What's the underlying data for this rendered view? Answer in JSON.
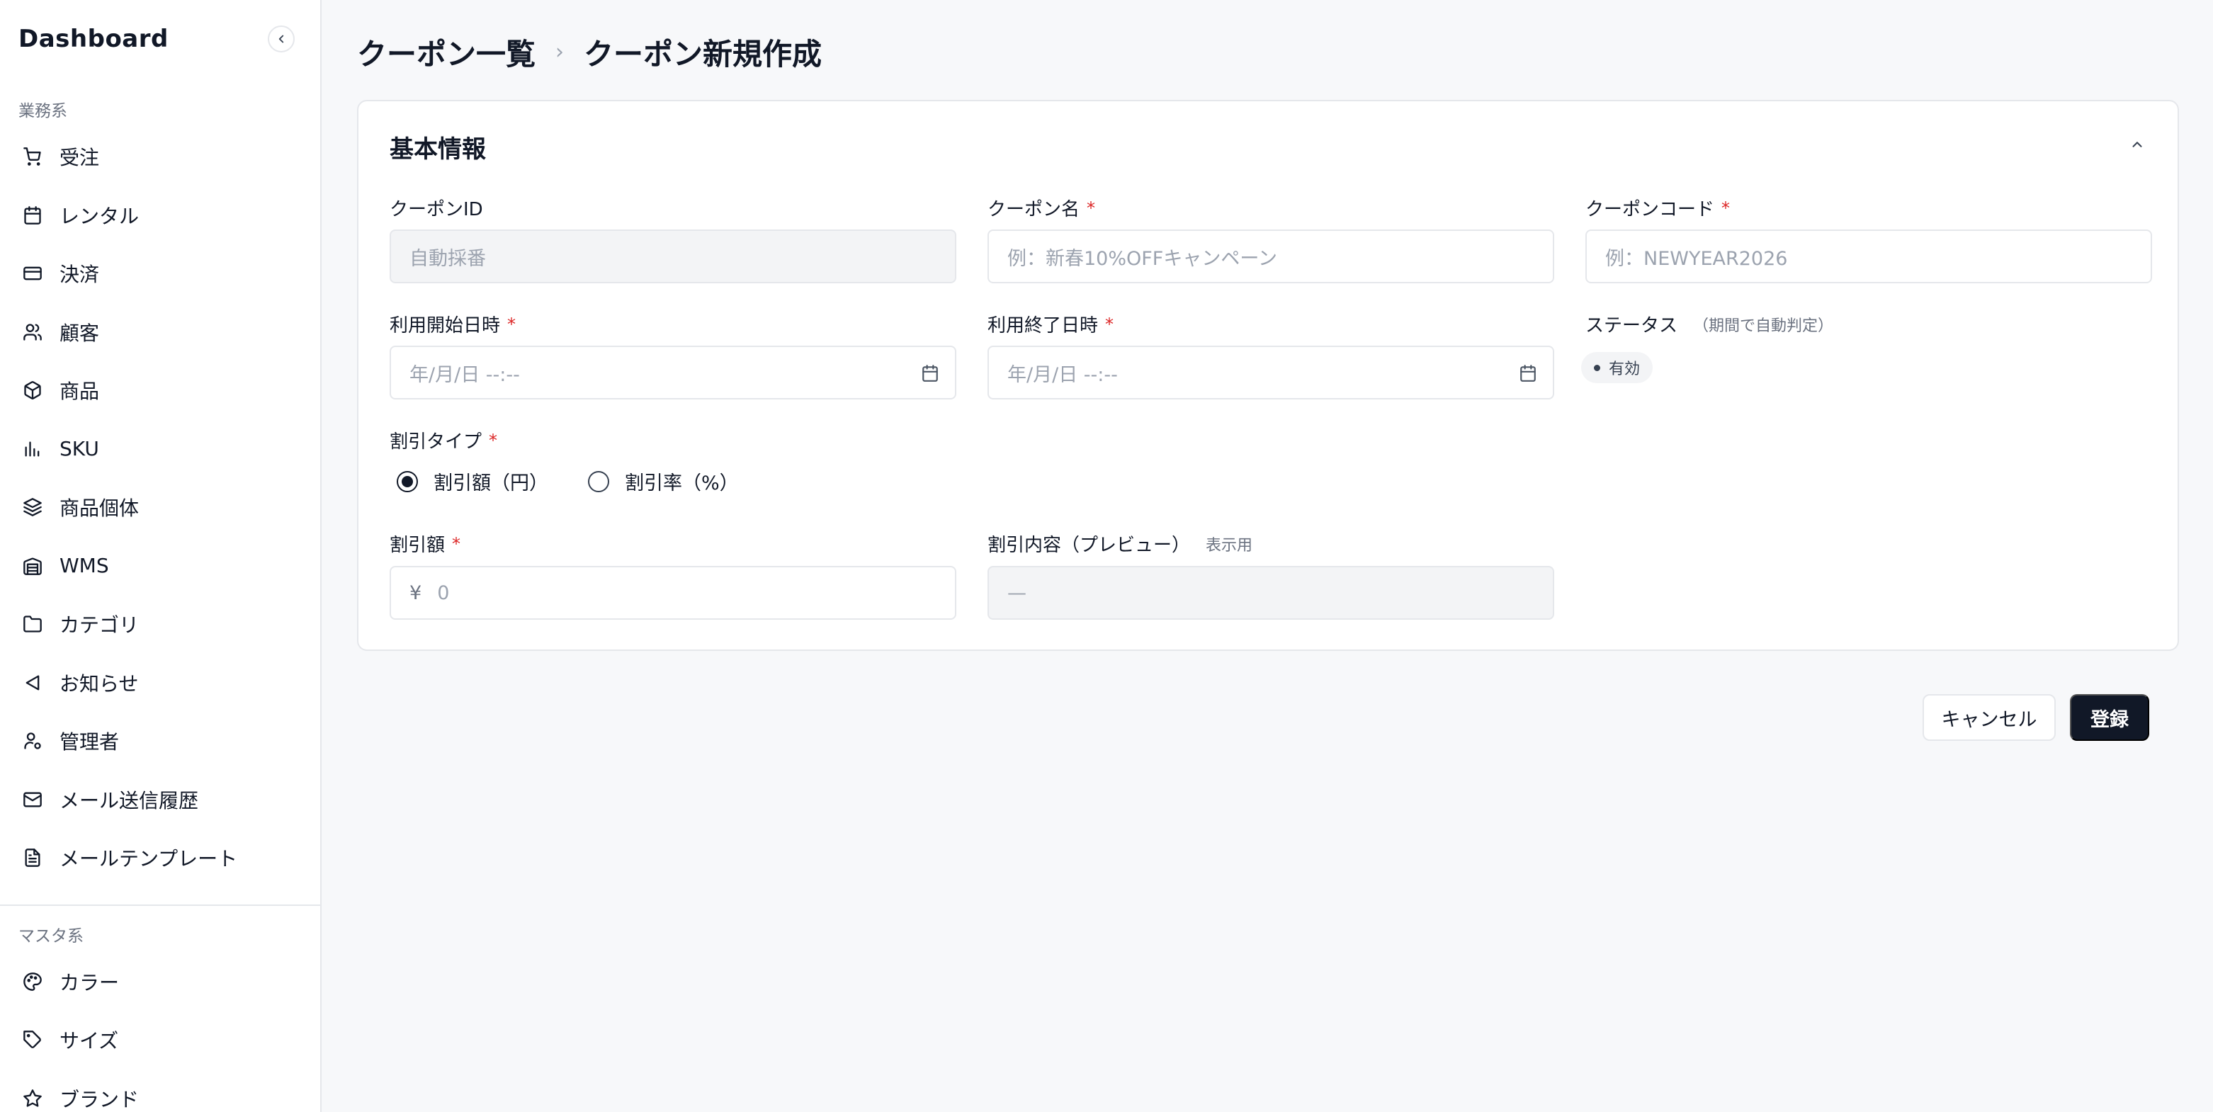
{
  "sidebar": {
    "title": "Dashboard",
    "section1_label": "業務系",
    "items": [
      {
        "label": "受注",
        "icon": "cart-icon"
      },
      {
        "label": "レンタル",
        "icon": "calendar-icon"
      },
      {
        "label": "決済",
        "icon": "credit-card-icon"
      },
      {
        "label": "顧客",
        "icon": "users-icon"
      },
      {
        "label": "商品",
        "icon": "box-icon"
      },
      {
        "label": "SKU",
        "icon": "bar-chart-icon"
      },
      {
        "label": "商品個体",
        "icon": "layers-icon"
      },
      {
        "label": "WMS",
        "icon": "warehouse-icon"
      },
      {
        "label": "カテゴリ",
        "icon": "folder-icon"
      },
      {
        "label": "お知らせ",
        "icon": "megaphone-icon"
      },
      {
        "label": "管理者",
        "icon": "user-cog-icon"
      },
      {
        "label": "メール送信履歴",
        "icon": "mail-icon"
      },
      {
        "label": "メールテンプレート",
        "icon": "file-text-icon"
      }
    ],
    "section2_label": "マスタ系",
    "items2": [
      {
        "label": "カラー",
        "icon": "palette-icon"
      },
      {
        "label": "サイズ",
        "icon": "tag-icon"
      },
      {
        "label": "ブランド",
        "icon": "star-icon"
      }
    ]
  },
  "breadcrumb": {
    "parent": "クーポン一覧",
    "separator": "›",
    "current": "クーポン新規作成"
  },
  "card": {
    "title": "基本情報",
    "fields": {
      "coupon_id": {
        "label": "クーポンID",
        "placeholder": "自動採番"
      },
      "coupon_name": {
        "label": "クーポン名",
        "required": "*",
        "placeholder": "例：新春10%OFFキャンペーン"
      },
      "coupon_code": {
        "label": "クーポンコード",
        "required": "*",
        "placeholder": "例：NEWYEAR2026"
      },
      "start_date": {
        "label": "利用開始日時",
        "required": "*",
        "placeholder": "年/月/日 --:--"
      },
      "end_date": {
        "label": "利用終了日時",
        "required": "*",
        "placeholder": "年/月/日 --:--"
      },
      "status": {
        "label": "ステータス",
        "note": "（期間で自動判定）",
        "value": "有効"
      },
      "discount_type": {
        "label": "割引タイプ",
        "required": "*",
        "options": [
          "割引額（円）",
          "割引率（%）"
        ],
        "selected": "割引額（円）"
      },
      "discount_amount": {
        "label": "割引額",
        "required": "*",
        "prefix": "¥",
        "placeholder": "0"
      },
      "discount_preview": {
        "label": "割引内容（プレビュー）",
        "note": "表示用",
        "value": "—"
      }
    }
  },
  "actions": {
    "cancel_label": "キャンセル",
    "submit_label": "登録"
  },
  "colors": {
    "primary": "#111827",
    "required": "#dc2626",
    "border": "#e5e7eb",
    "background": "#f7f8fa"
  }
}
